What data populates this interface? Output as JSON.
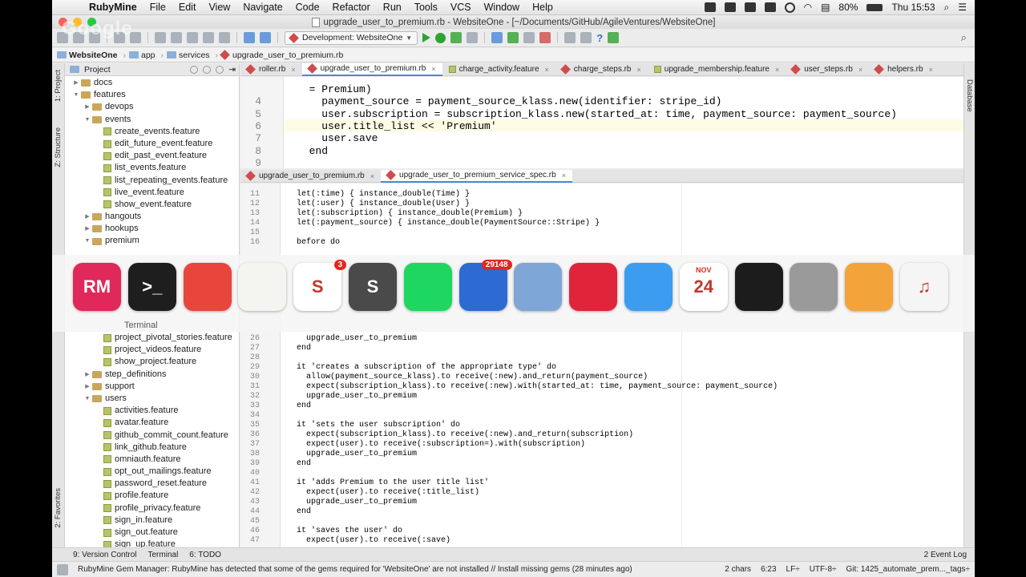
{
  "menubar": {
    "app_name": "RubyMine",
    "items": [
      "File",
      "Edit",
      "View",
      "Navigate",
      "Code",
      "Refactor",
      "Run",
      "Tools",
      "VCS",
      "Window",
      "Help"
    ],
    "battery": "80%",
    "clock": "Thu 15:53"
  },
  "window": {
    "title": "upgrade_user_to_premium.rb - WebsiteOne - [~/Documents/GitHub/AgileVentures/WebsiteOne]",
    "watermark": "Google"
  },
  "toolbar": {
    "run_config": "Development: WebsiteOne",
    "help": "?"
  },
  "breadcrumb": [
    "WebsiteOne",
    "app",
    "services",
    "upgrade_user_to_premium.rb"
  ],
  "project": {
    "header": "Project",
    "top_tree": [
      {
        "label": "docs",
        "type": "folder",
        "level": 1,
        "open": false
      },
      {
        "label": "features",
        "type": "folder",
        "level": 1,
        "open": true
      },
      {
        "label": "devops",
        "type": "folder",
        "level": 2,
        "open": false
      },
      {
        "label": "events",
        "type": "folder",
        "level": 2,
        "open": true
      },
      {
        "label": "create_events.feature",
        "type": "file",
        "level": 3
      },
      {
        "label": "edit_future_event.feature",
        "type": "file",
        "level": 3
      },
      {
        "label": "edit_past_event.feature",
        "type": "file",
        "level": 3
      },
      {
        "label": "list_events.feature",
        "type": "file",
        "level": 3
      },
      {
        "label": "list_repeating_events.feature",
        "type": "file",
        "level": 3
      },
      {
        "label": "live_event.feature",
        "type": "file",
        "level": 3
      },
      {
        "label": "show_event.feature",
        "type": "file",
        "level": 3
      },
      {
        "label": "hangouts",
        "type": "folder",
        "level": 2,
        "open": false
      },
      {
        "label": "hookups",
        "type": "folder",
        "level": 2,
        "open": false
      },
      {
        "label": "premium",
        "type": "folder",
        "level": 2,
        "open": true
      }
    ],
    "bottom_tree": [
      {
        "label": "project_pivotal_stories.feature",
        "type": "file",
        "level": 3
      },
      {
        "label": "project_videos.feature",
        "type": "file",
        "level": 3
      },
      {
        "label": "show_project.feature",
        "type": "file",
        "level": 3
      },
      {
        "label": "step_definitions",
        "type": "folder",
        "level": 2,
        "open": false
      },
      {
        "label": "support",
        "type": "folder",
        "level": 2,
        "open": false
      },
      {
        "label": "users",
        "type": "folder",
        "level": 2,
        "open": true
      },
      {
        "label": "activities.feature",
        "type": "file",
        "level": 3
      },
      {
        "label": "avatar.feature",
        "type": "file",
        "level": 3
      },
      {
        "label": "github_commit_count.feature",
        "type": "file",
        "level": 3
      },
      {
        "label": "link_github.feature",
        "type": "file",
        "level": 3
      },
      {
        "label": "omniauth.feature",
        "type": "file",
        "level": 3
      },
      {
        "label": "opt_out_mailings.feature",
        "type": "file",
        "level": 3
      },
      {
        "label": "password_reset.feature",
        "type": "file",
        "level": 3
      },
      {
        "label": "profile.feature",
        "type": "file",
        "level": 3
      },
      {
        "label": "profile_privacy.feature",
        "type": "file",
        "level": 3
      },
      {
        "label": "sign_in.feature",
        "type": "file",
        "level": 3
      },
      {
        "label": "sign_out.feature",
        "type": "file",
        "level": 3
      },
      {
        "label": "sign_up.feature",
        "type": "file",
        "level": 3
      }
    ]
  },
  "side_labels": {
    "project": "1: Project",
    "structure": "Z: Structure",
    "favorites": "2: Favorites",
    "database": "Database"
  },
  "tabs_top": [
    {
      "label": "roller.rb",
      "active": false
    },
    {
      "label": "upgrade_user_to_premium.rb",
      "active": true
    },
    {
      "label": "charge_activity.feature",
      "active": false
    },
    {
      "label": "charge_steps.rb",
      "active": false
    },
    {
      "label": "upgrade_membership.feature",
      "active": false
    },
    {
      "label": "user_steps.rb",
      "active": false
    },
    {
      "label": "helpers.rb",
      "active": false
    }
  ],
  "tabs_bottom": [
    {
      "label": "upgrade_user_to_premium.rb",
      "active": false
    },
    {
      "label": "upgrade_user_to_premium_service_spec.rb",
      "active": true
    }
  ],
  "editor_top": {
    "lines": [
      {
        "n": "",
        "text": "  = Premium)"
      },
      {
        "n": "4",
        "text": "    payment_source = payment_source_klass.new(identifier: stripe_id)"
      },
      {
        "n": "5",
        "text": "    user.subscription = subscription_klass.new(started_at: time, payment_source: payment_source)"
      },
      {
        "n": "6",
        "text": "    user.title_list << 'Premium'"
      },
      {
        "n": "7",
        "text": "    user.save"
      },
      {
        "n": "8",
        "text": "  end"
      },
      {
        "n": "9",
        "text": ""
      }
    ]
  },
  "editor_bottom": {
    "lines_top": [
      {
        "n": "11",
        "text": "  let(:time) { instance_double(Time) }"
      },
      {
        "n": "12",
        "text": "  let(:user) { instance_double(User) }"
      },
      {
        "n": "13",
        "text": "  let(:subscription) { instance_double(Premium) }"
      },
      {
        "n": "14",
        "text": "  let(:payment_source) { instance_double(PaymentSource::Stripe) }"
      },
      {
        "n": "15",
        "text": ""
      },
      {
        "n": "16",
        "text": "  before do"
      }
    ],
    "lines_bottom": [
      {
        "n": "26",
        "text": "    upgrade_user_to_premium"
      },
      {
        "n": "27",
        "text": "  end"
      },
      {
        "n": "28",
        "text": ""
      },
      {
        "n": "29",
        "text": "  it 'creates a subscription of the appropriate type' do"
      },
      {
        "n": "30",
        "text": "    allow(payment_source_klass).to receive(:new).and_return(payment_source)"
      },
      {
        "n": "31",
        "text": "    expect(subscription_klass).to receive(:new).with(started_at: time, payment_source: payment_source)"
      },
      {
        "n": "32",
        "text": "    upgrade_user_to_premium"
      },
      {
        "n": "33",
        "text": "  end"
      },
      {
        "n": "34",
        "text": ""
      },
      {
        "n": "35",
        "text": "  it 'sets the user subscription' do"
      },
      {
        "n": "36",
        "text": "    expect(subscription_klass).to receive(:new).and_return(subscription)"
      },
      {
        "n": "37",
        "text": "    expect(user).to receive(:subscription=).with(subscription)"
      },
      {
        "n": "38",
        "text": "    upgrade_user_to_premium"
      },
      {
        "n": "39",
        "text": "  end"
      },
      {
        "n": "40",
        "text": ""
      },
      {
        "n": "41",
        "text": "  it 'adds Premium to the user title list'"
      },
      {
        "n": "42",
        "text": "    expect(user).to receive(:title_list)"
      },
      {
        "n": "43",
        "text": "    upgrade_user_to_premium"
      },
      {
        "n": "44",
        "text": "  end"
      },
      {
        "n": "45",
        "text": ""
      },
      {
        "n": "46",
        "text": "  it 'saves the user' do"
      },
      {
        "n": "47",
        "text": "    expect(user).to receive(:save)"
      }
    ]
  },
  "dock": {
    "hover_label": "Terminal",
    "items": [
      {
        "name": "rubymine",
        "color": "#e0285a",
        "text": "RM"
      },
      {
        "name": "terminal",
        "color": "#1e1e1e",
        "text": ">_"
      },
      {
        "name": "chrome",
        "color": "#e8453c",
        "text": ""
      },
      {
        "name": "textedit",
        "color": "#f4f4f0",
        "text": ""
      },
      {
        "name": "slack",
        "color": "#ffffff",
        "text": "S",
        "badge": "3"
      },
      {
        "name": "sublime",
        "color": "#4a4a4a",
        "text": "S"
      },
      {
        "name": "spotify",
        "color": "#1ed760",
        "text": ""
      },
      {
        "name": "thunderbird",
        "color": "#2d6bd2",
        "text": "",
        "badge": "29148"
      },
      {
        "name": "preview",
        "color": "#7ea6d6",
        "text": ""
      },
      {
        "name": "clear",
        "color": "#e0243a",
        "text": ""
      },
      {
        "name": "finder",
        "color": "#3c9cf0",
        "text": ""
      },
      {
        "name": "calendar",
        "color": "#ffffff",
        "text": "24",
        "sub": "NOV"
      },
      {
        "name": "activity-monitor",
        "color": "#1c1c1c",
        "text": ""
      },
      {
        "name": "calculator",
        "color": "#9a9a9a",
        "text": ""
      },
      {
        "name": "pages",
        "color": "#f2a33a",
        "text": ""
      },
      {
        "name": "itunes",
        "color": "#f5f5f5",
        "text": "♫"
      }
    ]
  },
  "bottom_tools": [
    "9: Version Control",
    "Terminal",
    "6: TODO"
  ],
  "event_log": "2 Event Log",
  "status": {
    "message": "RubyMine Gem Manager: RubyMine has detected that some of the gems required for 'WebsiteOne' are not installed // Install missing gems (28 minutes ago)",
    "chars": "2 chars",
    "position": "6:23",
    "line_sep": "LF÷",
    "encoding": "UTF-8÷",
    "git": "Git: 1425_automate_prem..._tags÷"
  }
}
